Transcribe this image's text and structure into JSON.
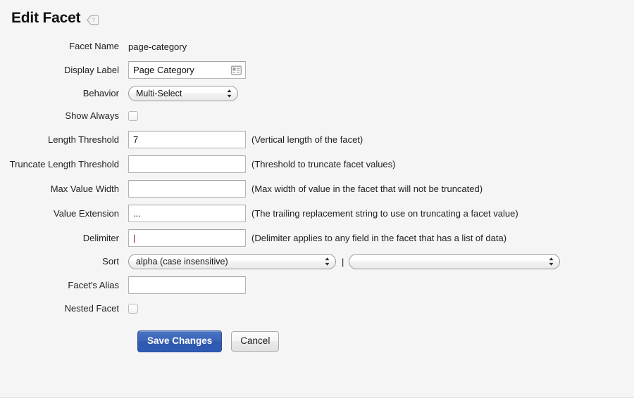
{
  "header": {
    "title": "Edit Facet",
    "help_icon": "help-tag-icon"
  },
  "form": {
    "rows": [
      {
        "label": "Facet Name",
        "value": "page-category",
        "hint": ""
      },
      {
        "label": "Display Label",
        "value": "Page Category",
        "hint": ""
      },
      {
        "label": "Behavior",
        "value": "Multi-Select",
        "hint": ""
      },
      {
        "label": "Show Always",
        "value": "",
        "hint": ""
      },
      {
        "label": "Length Threshold",
        "value": "7",
        "hint": "(Vertical length of the facet)"
      },
      {
        "label": "Truncate Length Threshold",
        "value": "",
        "hint": "(Threshold to truncate facet values)"
      },
      {
        "label": "Max Value Width",
        "value": "",
        "hint": "(Max width of value in the facet that will not be truncated)"
      },
      {
        "label": "Value Extension",
        "value": "...",
        "hint": "(The trailing replacement string to use on truncating a facet value)"
      },
      {
        "label": "Delimiter",
        "value": "|",
        "hint": "(Delimiter applies to any field in the facet that has a list of data)"
      },
      {
        "label": "Sort",
        "value": "alpha (case insensitive)",
        "hint": ""
      },
      {
        "label": "Facet's Alias",
        "value": "",
        "hint": ""
      },
      {
        "label": "Nested Facet",
        "value": "",
        "hint": ""
      }
    ],
    "sort_separator": "|",
    "sort_secondary_value": "",
    "display_label_icon": "contact-card-icon",
    "show_always_checked": false,
    "nested_facet_checked": false
  },
  "buttons": {
    "save_label": "Save Changes",
    "cancel_label": "Cancel",
    "primary_color": "#3059ae"
  }
}
